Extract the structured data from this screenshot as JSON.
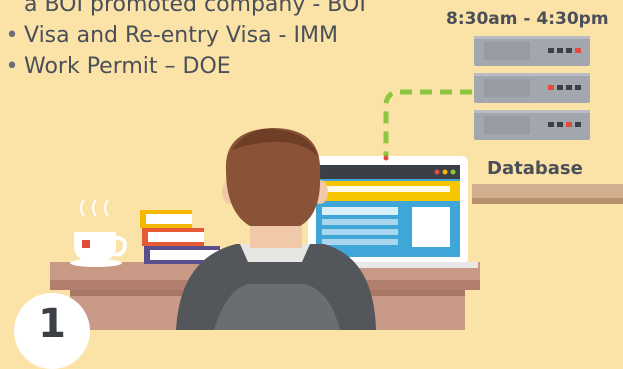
{
  "bullets": [
    {
      "bullet": "",
      "text": "a BOI promoted company - BOI",
      "continuation": true
    },
    {
      "bullet": "•",
      "text": "Visa and Re-entry Visa - IMM",
      "continuation": false
    },
    {
      "bullet": "•",
      "text": "Work Permit – DOE",
      "continuation": false
    }
  ],
  "hours": "8:30am - 4:30pm",
  "database_label": "Database",
  "step_number": "1",
  "colors": {
    "background": "#FBE3A8",
    "text": "#4A4F58",
    "server": "#9FA3AA",
    "connector": "#8DC63F",
    "screen": "#3FA7D8",
    "desk": "#C89A86"
  },
  "icons": [
    "server-icon",
    "laptop-icon",
    "tea-cup-icon",
    "books-icon",
    "person-icon"
  ]
}
